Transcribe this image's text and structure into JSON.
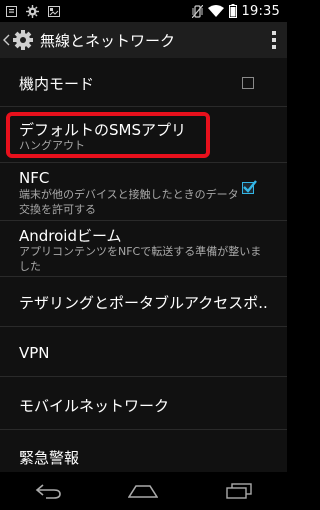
{
  "status_bar": {
    "time": "19:35",
    "left_icons": [
      "notification-icon",
      "android-debug-icon",
      "gallery-icon"
    ],
    "right_icons": [
      "vibrate-icon",
      "wifi-icon",
      "battery-icon"
    ]
  },
  "action_bar": {
    "title": "無線とネットワーク",
    "icon": "settings-gear-icon",
    "overflow": "overflow-menu-icon"
  },
  "items": [
    {
      "id": "airplane",
      "title": "機内モード",
      "summary": "",
      "checkbox": true,
      "checked": false
    },
    {
      "id": "default-sms",
      "title": "デフォルトのSMSアプリ",
      "summary": "ハングアウト",
      "checkbox": false
    },
    {
      "id": "nfc",
      "title": "NFC",
      "summary": "端末が他のデバイスと接触したときのデータ交換を許可する",
      "checkbox": true,
      "checked": true
    },
    {
      "id": "android-beam",
      "title": "Androidビーム",
      "summary": "アプリコンテンツをNFCで転送する準備が整いました",
      "checkbox": false
    },
    {
      "id": "tethering",
      "title": "テザリングとポータブルアクセスポ..",
      "summary": "",
      "checkbox": false
    },
    {
      "id": "vpn",
      "title": "VPN",
      "summary": "",
      "checkbox": false
    },
    {
      "id": "mobile-network",
      "title": "モバイルネットワーク",
      "summary": "",
      "checkbox": false
    },
    {
      "id": "emergency",
      "title": "緊急警報",
      "summary": "",
      "checkbox": false
    }
  ],
  "nav_bar": {
    "buttons": [
      "back-icon",
      "home-icon",
      "recents-icon"
    ]
  },
  "colors": {
    "accent": "#33b5e5",
    "highlight": "#e8101c",
    "background": "#111111"
  }
}
